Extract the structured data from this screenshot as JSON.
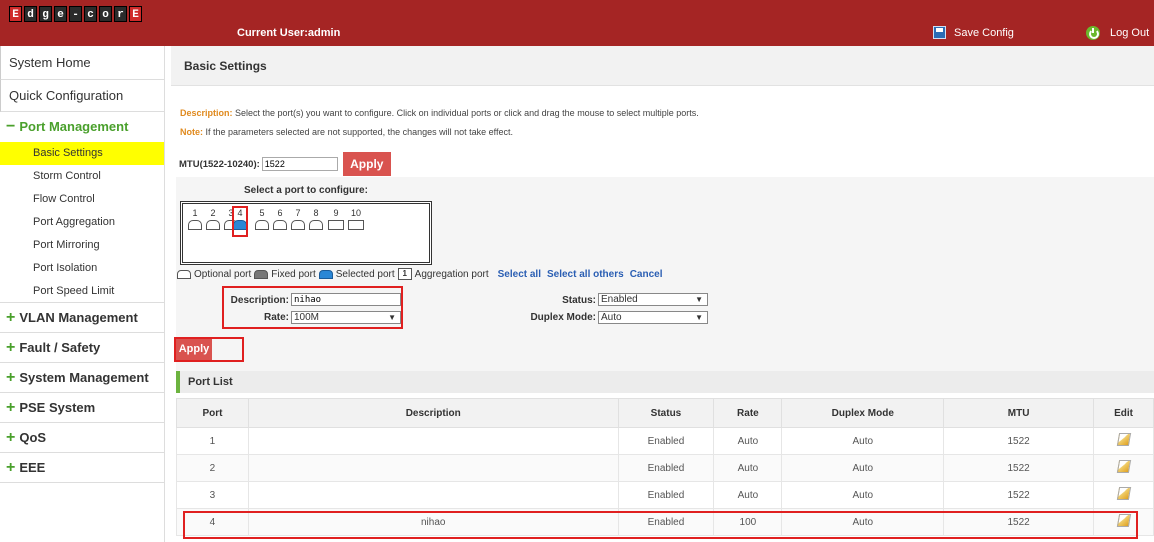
{
  "header": {
    "logo_letters": [
      "E",
      "d",
      "g",
      "e",
      "-",
      "c",
      "o",
      "r",
      "E"
    ],
    "current_user": "Current User:admin",
    "save_config": "Save Config",
    "log_out": "Log Out"
  },
  "sidebar": {
    "system_home": "System Home",
    "quick_configuration": "Quick Configuration",
    "port_management": "Port Management",
    "port_items": [
      "Basic Settings",
      "Storm Control",
      "Flow Control",
      "Port Aggregation",
      "Port Mirroring",
      "Port Isolation",
      "Port Speed Limit"
    ],
    "groups": [
      "VLAN Management",
      "Fault / Safety",
      "System Management",
      "PSE System",
      "QoS",
      "EEE"
    ]
  },
  "main": {
    "title": "Basic Settings",
    "description_label": "Description:",
    "description_text": " Select the port(s) you want to configure. Click on individual ports or click and drag the mouse to select multiple ports.",
    "note_label": "Note:",
    "note_text": " If the parameters selected are not supported, the changes will not take effect.",
    "mtu_label": "MTU(1522-10240):",
    "mtu_value": "1522",
    "apply": "Apply",
    "select_port_title": "Select a port to configure:",
    "ports": [
      "1",
      "2",
      "3",
      "4",
      "5",
      "6",
      "7",
      "8",
      "9",
      "10"
    ],
    "legend": {
      "optional": "Optional port",
      "fixed": "Fixed port",
      "selected": "Selected port",
      "agg_num": "1",
      "aggregation": "Aggregation port",
      "select_all": "Select all",
      "select_all_others": "Select all others",
      "cancel": "Cancel"
    },
    "form": {
      "description_label": "Description:",
      "description_value": "nihao",
      "rate_label": "Rate:",
      "rate_value": "100M",
      "status_label": "Status:",
      "status_value": "Enabled",
      "duplex_label": "Duplex Mode:",
      "duplex_value": "Auto"
    },
    "apply2": "Apply",
    "port_list_title": "Port List",
    "table": {
      "headers": [
        "Port",
        "Description",
        "Status",
        "Rate",
        "Duplex Mode",
        "MTU",
        "Edit"
      ],
      "rows": [
        [
          "1",
          "",
          "Enabled",
          "Auto",
          "Auto",
          "1522"
        ],
        [
          "2",
          "",
          "Enabled",
          "Auto",
          "Auto",
          "1522"
        ],
        [
          "3",
          "",
          "Enabled",
          "Auto",
          "Auto",
          "1522"
        ],
        [
          "4",
          "nihao",
          "Enabled",
          "100",
          "Auto",
          "1522"
        ]
      ]
    }
  }
}
